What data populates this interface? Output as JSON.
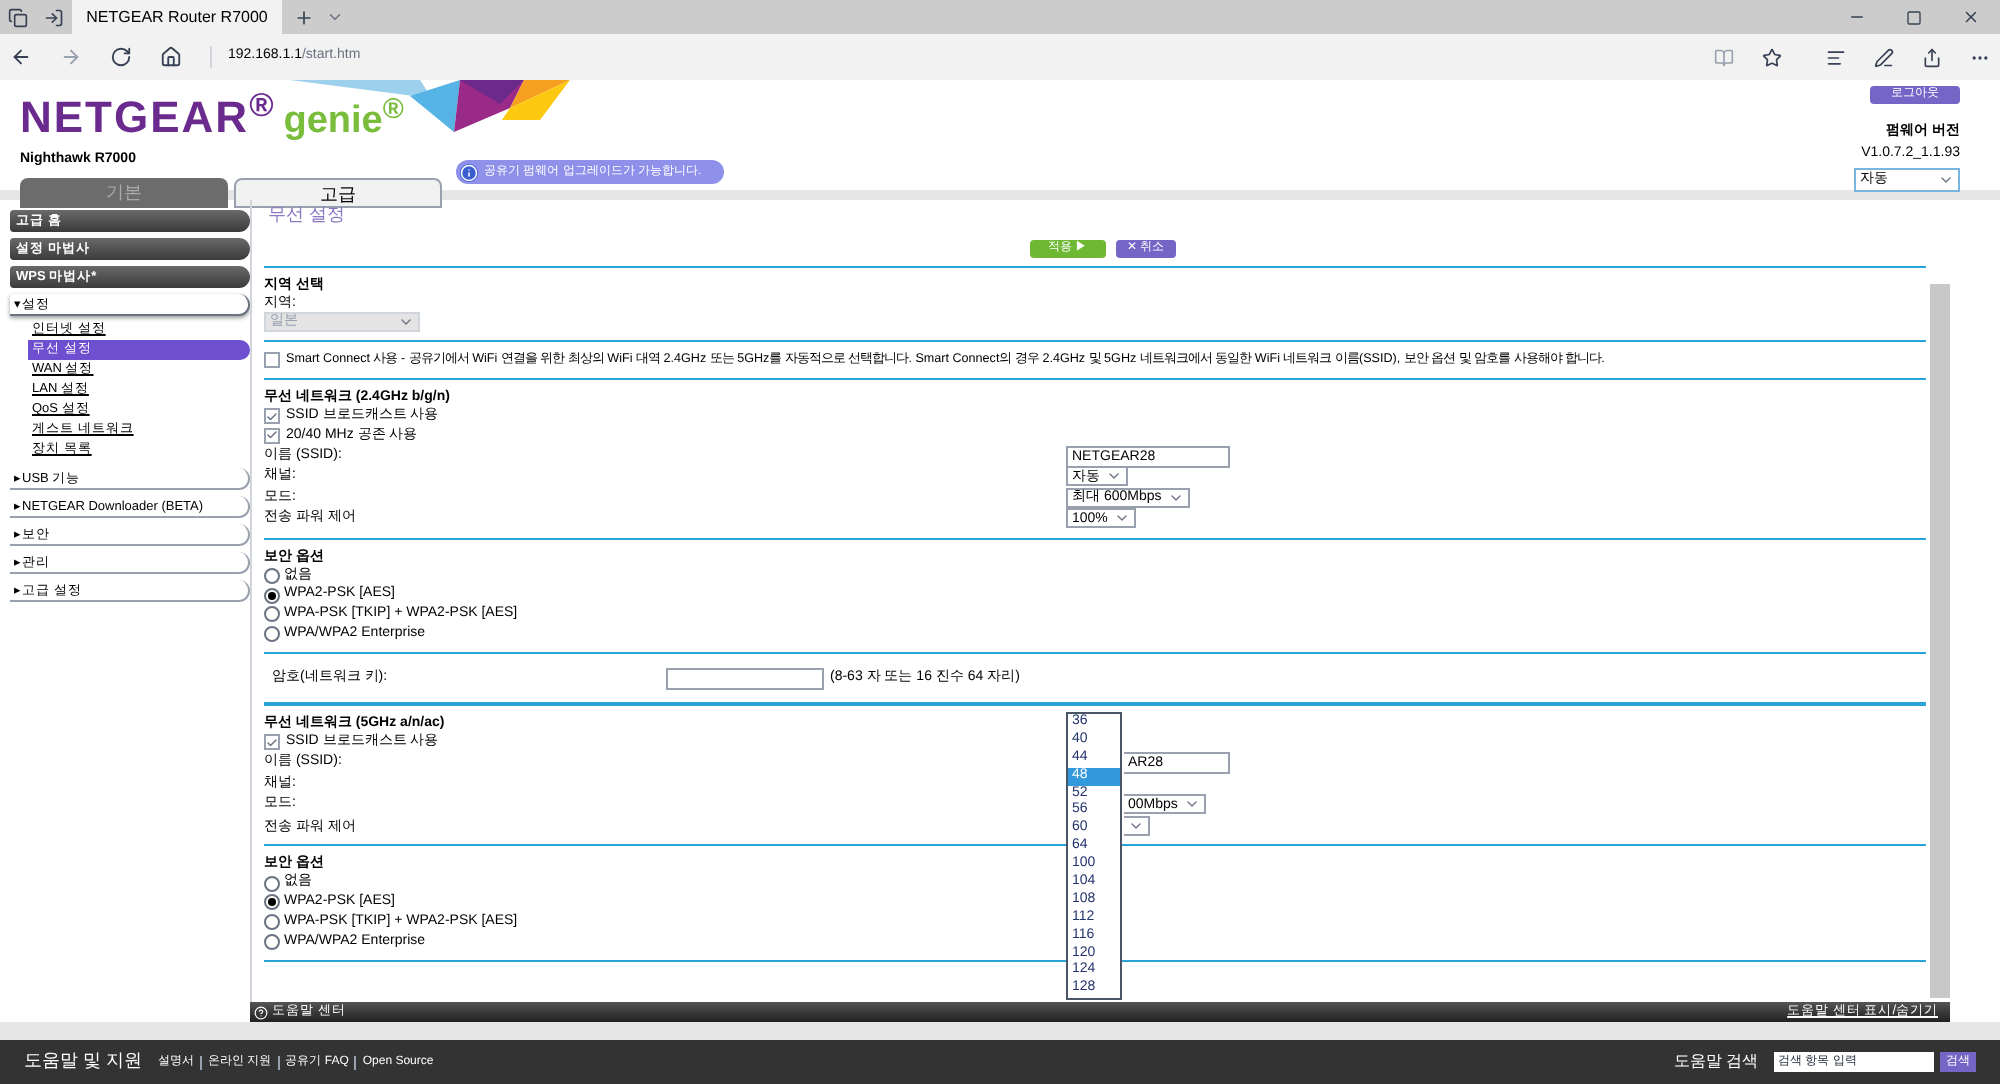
{
  "browser": {
    "tab_title": "NETGEAR Router R7000",
    "url_host": "192.168.1.1",
    "url_path": "/start.htm"
  },
  "header": {
    "brand": "NETGEAR$^{®}$",
    "product": "genie$^{®}$",
    "model": "Nighthawk R7000",
    "tabs": [
      {
        "label": "기본",
        "selected": false
      },
      {
        "label": "고급",
        "selected": true
      }
    ],
    "notice": "공유기 펌웨어 업그레이드가 가능합니다.",
    "logout": "로그아웃",
    "firmware_label": "펌웨어 버전",
    "firmware_version": "V1.0.7.2_1.1.93",
    "language": "자동"
  },
  "sidebar": {
    "items": [
      {
        "label": "고급 홈",
        "kind": "dark"
      },
      {
        "label": "설정 마법사",
        "kind": "dark"
      },
      {
        "label": "WPS 마법사*",
        "kind": "dark"
      },
      {
        "label": "▾설정",
        "kind": "group",
        "expanded": true,
        "children": [
          {
            "label": "인터넷 설정",
            "selected": false
          },
          {
            "label": "무선 설정",
            "selected": true
          },
          {
            "label": "WAN 설정",
            "selected": false
          },
          {
            "label": "LAN 설정",
            "selected": false
          },
          {
            "label": "QoS 설정",
            "selected": false
          },
          {
            "label": "게스트 네트워크",
            "selected": false
          },
          {
            "label": "장치 목록",
            "selected": false
          }
        ]
      },
      {
        "label": "▸USB 기능",
        "kind": "group"
      },
      {
        "label": "▸NETGEAR Downloader (BETA)",
        "kind": "group"
      },
      {
        "label": "▸보안",
        "kind": "group"
      },
      {
        "label": "▸관리",
        "kind": "group"
      },
      {
        "label": "▸고급 설정",
        "kind": "group"
      }
    ]
  },
  "page": {
    "title": "무선 설정",
    "apply": "적용 ▶",
    "cancel": "✕ 취소"
  },
  "region": {
    "heading": "지역 선택",
    "label": "지역:",
    "value": "일본",
    "disabled": true
  },
  "smart_connect": {
    "checked": false,
    "text": "Smart Connect 사용 - 공유기에서 WiFi 연결을 위한 최상의 WiFi 대역 2.4GHz 또는 5GHz를 자동적으로 선택합니다. Smart Connect의 경우 2.4GHz 및 5GHz 네트워크에서 동일한 WiFi 네트워크 이름(SSID), 보안 옵션 및 암호를 사용해야 합니다."
  },
  "networks": [
    {
      "heading": "무선 네트워크 (2.4GHz b/g/n)",
      "checkboxes": [
        {
          "label": "SSID 브로드캐스트 사용",
          "checked": true
        },
        {
          "label": "20/40 MHz 공존 사용",
          "checked": true
        }
      ],
      "fields": [
        {
          "label": "이름 (SSID):",
          "kind": "text",
          "value": "NETGEAR28"
        },
        {
          "label": "채널:",
          "kind": "select",
          "value": "자동"
        },
        {
          "label": "모드:",
          "kind": "select",
          "value": "최대 600Mbps"
        },
        {
          "label": "전송 파워 제어",
          "kind": "select",
          "value": "100%"
        }
      ],
      "security": {
        "heading": "보안 옵션",
        "options": [
          {
            "label": "없음",
            "selected": false
          },
          {
            "label": "WPA2-PSK [AES]",
            "selected": true
          },
          {
            "label": "WPA-PSK [TKIP] + WPA2-PSK [AES]",
            "selected": false
          },
          {
            "label": "WPA/WPA2 Enterprise",
            "selected": false
          }
        ]
      },
      "password": {
        "label": "암호(네트워크 키):",
        "hint": "(8-63 자 또는 16 진수 64 자리)"
      }
    },
    {
      "heading": "무선 네트워크 (5GHz a/n/ac)",
      "checkboxes": [
        {
          "label": "SSID 브로드캐스트 사용",
          "checked": true
        }
      ],
      "fields": [
        {
          "label": "이름 (SSID):",
          "kind": "text",
          "value": "AR28"
        },
        {
          "label": "채널:",
          "kind": "open",
          "options": [
            {
              "label": "36",
              "selected": false
            },
            {
              "label": "40",
              "selected": false
            },
            {
              "label": "44",
              "selected": false
            },
            {
              "label": "48",
              "selected": true
            },
            {
              "label": "52",
              "selected": false
            },
            {
              "label": "56",
              "selected": false
            },
            {
              "label": "60",
              "selected": false
            },
            {
              "label": "64",
              "selected": false
            },
            {
              "label": "100",
              "selected": false
            },
            {
              "label": "104",
              "selected": false
            },
            {
              "label": "108",
              "selected": false
            },
            {
              "label": "112",
              "selected": false
            },
            {
              "label": "116",
              "selected": false
            },
            {
              "label": "120",
              "selected": false
            },
            {
              "label": "124",
              "selected": false
            },
            {
              "label": "128",
              "selected": false
            }
          ]
        },
        {
          "label": "모드:",
          "kind": "select",
          "value": "00Mbps"
        },
        {
          "label": "전송 파워 제어",
          "kind": "select"
        }
      ],
      "security": {
        "heading": "보안 옵션",
        "options": [
          {
            "label": "없음",
            "selected": false
          },
          {
            "label": "WPA2-PSK [AES]",
            "selected": true
          },
          {
            "label": "WPA-PSK [TKIP] + WPA2-PSK [AES]",
            "selected": false
          },
          {
            "label": "WPA/WPA2 Enterprise",
            "selected": false
          }
        ]
      }
    }
  ],
  "help_bar": {
    "title": "도움말 센터",
    "toggle": "도움말 센터 표시/숨기기"
  },
  "footer": {
    "title": "도움말 및 지원",
    "links": [
      "설명서",
      "온라인 지원",
      "공유기 FAQ",
      "Open Source"
    ],
    "search_label": "도움말 검색",
    "search_placeholder": "검색 항목 입력",
    "search_button": "검색"
  }
}
